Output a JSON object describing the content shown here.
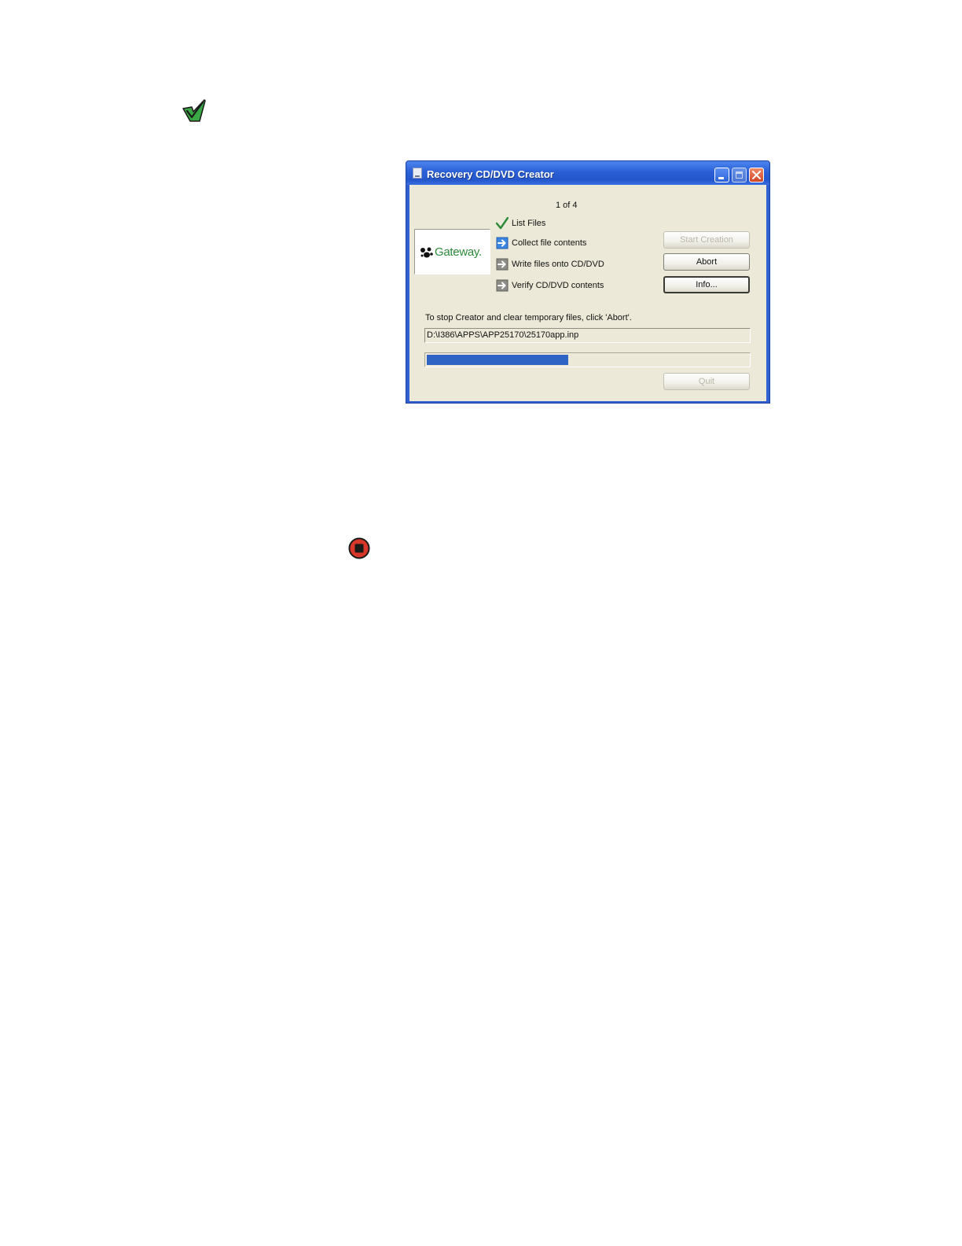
{
  "icons": {
    "note": "checkmark-note-icon",
    "stop": "stop-caution-icon"
  },
  "window": {
    "title": "Recovery CD/DVD Creator",
    "step_counter": "1 of 4",
    "logo_text": "Gateway.",
    "steps": [
      {
        "label": "List Files",
        "state": "done",
        "icon": "checkmark-icon"
      },
      {
        "label": "Collect file contents",
        "state": "current",
        "icon": "arrow-right-icon"
      },
      {
        "label": "Write files onto CD/DVD",
        "state": "pending",
        "icon": "arrow-right-icon"
      },
      {
        "label": "Verify CD/DVD contents",
        "state": "pending",
        "icon": "arrow-right-icon"
      }
    ],
    "buttons": {
      "start_creation": "Start Creation",
      "abort": "Abort",
      "info": "Info...",
      "quit": "Quit"
    },
    "status_text": "To stop Creator and clear temporary files, click 'Abort'.",
    "current_file": "D:\\I386\\APPS\\APP25170\\25170app.inp",
    "progress_fraction": 0.44
  },
  "colors": {
    "note_icon_green": "#3aa845",
    "stop_icon_red": "#d8382a",
    "title_bar_blue": "#2a5fd6",
    "progress_blue": "#2f64c4",
    "logo_green": "#2e8b3a"
  }
}
